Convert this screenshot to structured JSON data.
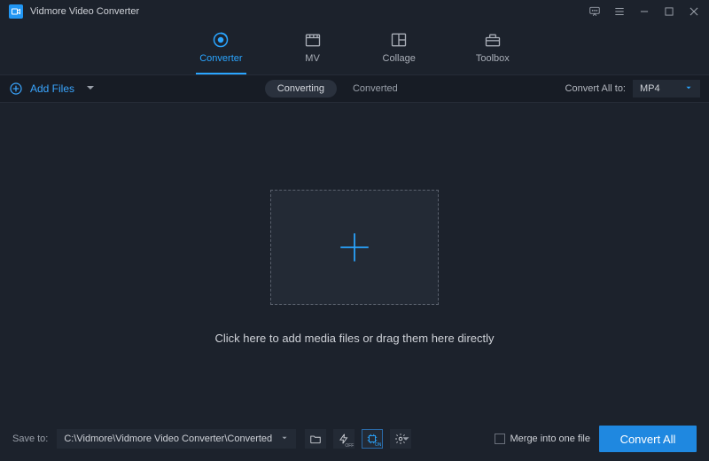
{
  "app_title": "Vidmore Video Converter",
  "nav": {
    "converter": "Converter",
    "mv": "MV",
    "collage": "Collage",
    "toolbox": "Toolbox"
  },
  "toolbar": {
    "add_files": "Add Files",
    "converting": "Converting",
    "converted": "Converted",
    "convert_all_to_label": "Convert All to:",
    "output_format": "MP4"
  },
  "workspace": {
    "hint": "Click here to add media files or drag them here directly"
  },
  "footer": {
    "save_to_label": "Save to:",
    "save_path": "C:\\Vidmore\\Vidmore Video Converter\\Converted",
    "merge_label": "Merge into one file",
    "merge_checked": false,
    "convert_all_btn": "Convert All"
  },
  "colors": {
    "accent": "#2aa5ff",
    "primary_button": "#1f88e0",
    "bg": "#1c222c",
    "panel": "#232a35"
  }
}
